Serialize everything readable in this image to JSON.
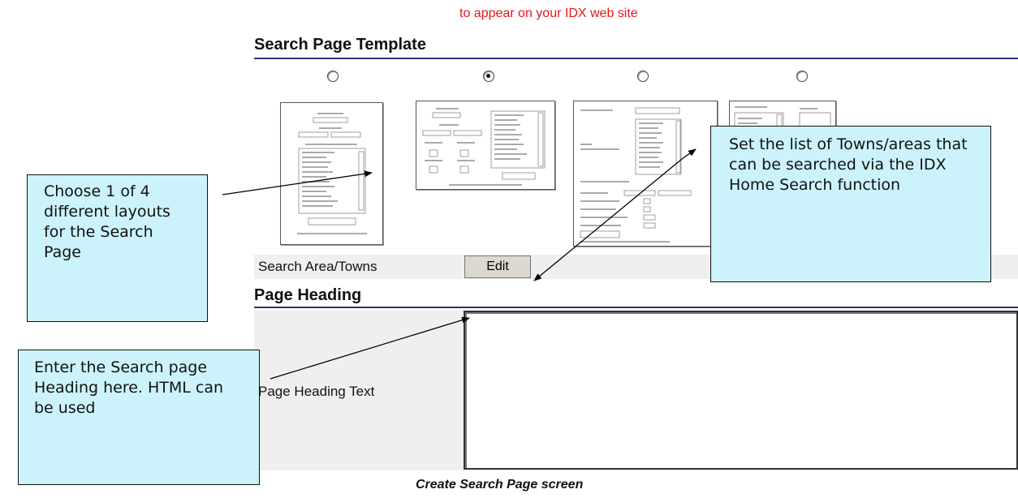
{
  "header": {
    "top_note": "to appear on your IDX web site"
  },
  "template_section": {
    "title": "Search Page Template",
    "layouts": [
      {
        "selected": false
      },
      {
        "selected": true
      },
      {
        "selected": false
      },
      {
        "selected": false
      }
    ]
  },
  "search_area": {
    "label": "Search Area/Towns",
    "edit_label": "Edit"
  },
  "heading_section": {
    "title": "Page Heading",
    "field_label": "Page Heading Text",
    "value": ""
  },
  "callouts": {
    "layouts": "Choose 1 of 4 different layouts for the Search Page",
    "towns": "Set the list of Towns/areas that can be searched via the IDX Home Search function",
    "heading": "Enter the Search page Heading here.  HTML can be used"
  },
  "caption": "Create Search Page screen",
  "colors": {
    "accent_red": "#e8141c",
    "rule_blue": "#2a2d8a",
    "callout_bg": "#ccf3fc"
  }
}
